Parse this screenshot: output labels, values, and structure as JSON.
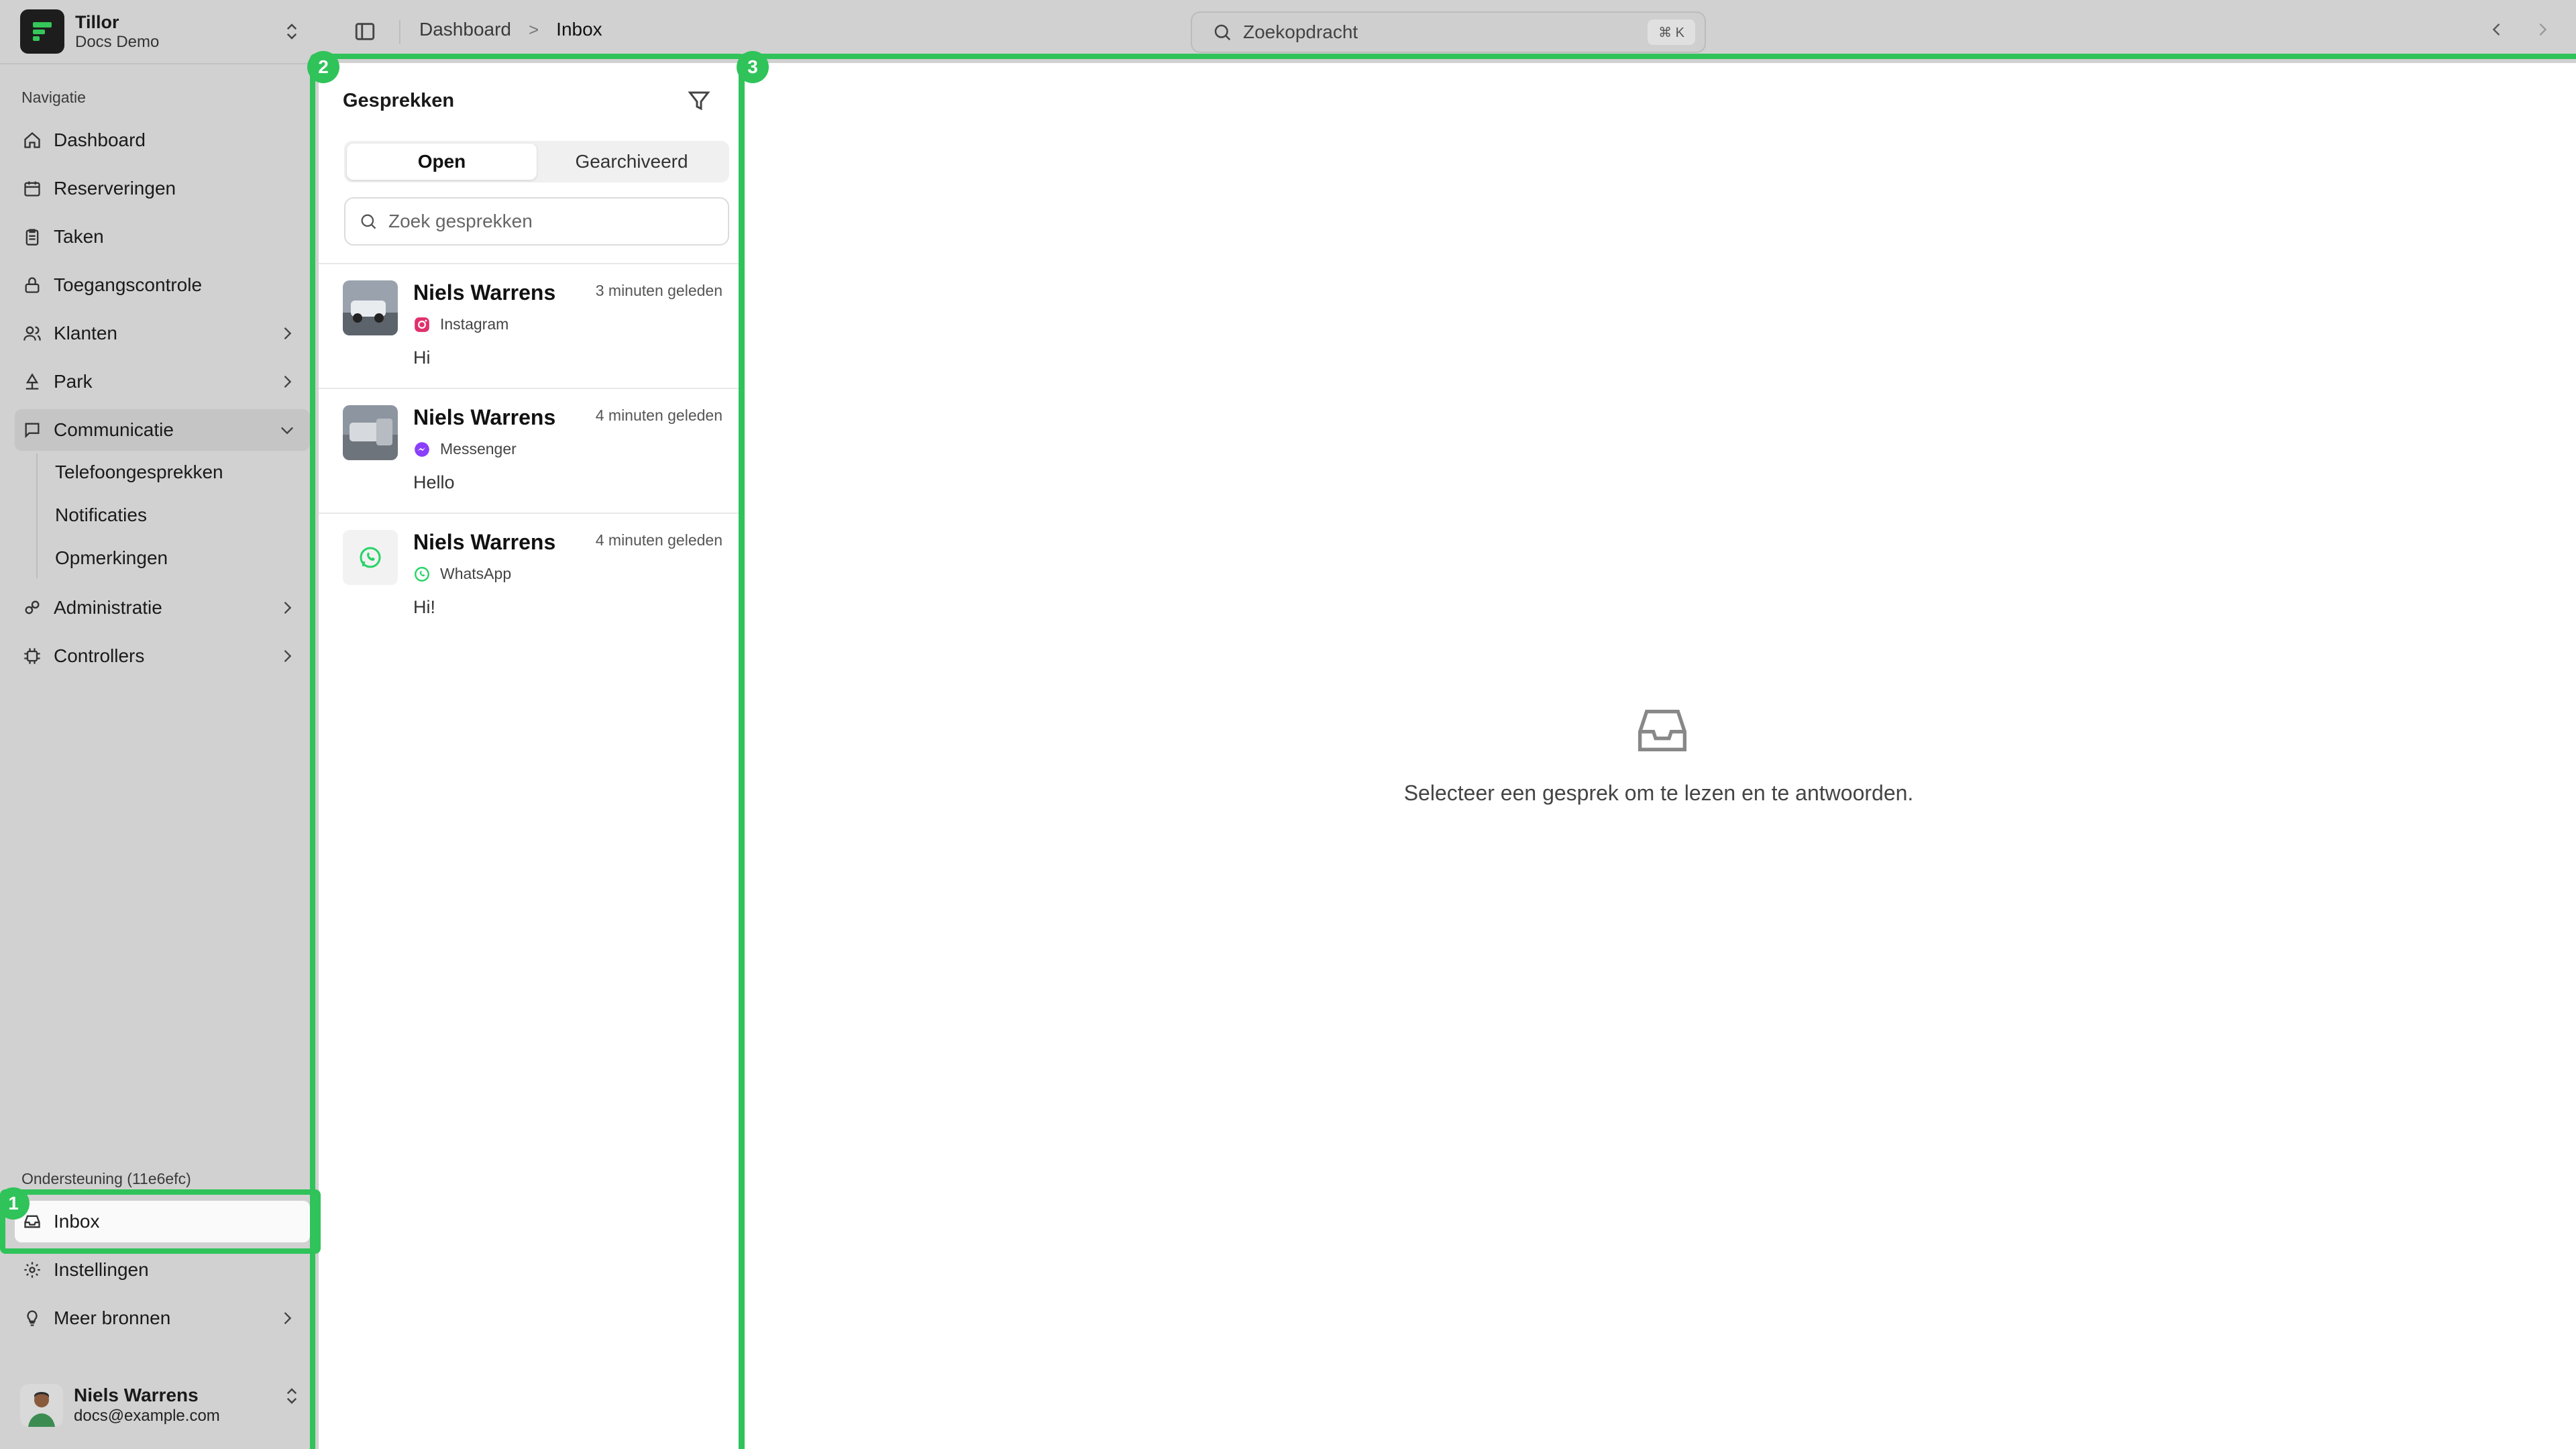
{
  "brand": {
    "name": "Tillor",
    "workspace": "Docs Demo"
  },
  "sidebar": {
    "section_nav": "Navigatie",
    "items": [
      {
        "label": "Dashboard",
        "icon": "home-icon"
      },
      {
        "label": "Reserveringen",
        "icon": "calendar-icon"
      },
      {
        "label": "Taken",
        "icon": "clipboard-icon"
      },
      {
        "label": "Toegangscontrole",
        "icon": "lock-icon"
      },
      {
        "label": "Klanten",
        "icon": "users-icon"
      },
      {
        "label": "Park",
        "icon": "park-icon"
      },
      {
        "label": "Communicatie",
        "icon": "chat-icon"
      },
      {
        "label": "Administratie",
        "icon": "admin-icon"
      },
      {
        "label": "Controllers",
        "icon": "chip-icon"
      }
    ],
    "communicatie_sub": [
      "Telefoongesprekken",
      "Notificaties",
      "Opmerkingen"
    ],
    "section_support": "Ondersteuning (11e6efc)",
    "support_items": [
      {
        "label": "Inbox",
        "icon": "inbox-icon"
      },
      {
        "label": "Instellingen",
        "icon": "gear-icon"
      },
      {
        "label": "Meer bronnen",
        "icon": "lightbulb-icon"
      }
    ],
    "user": {
      "name": "Niels Warrens",
      "email": "docs@example.com"
    }
  },
  "topbar": {
    "breadcrumb_parent": "Dashboard",
    "breadcrumb_sep": ">",
    "breadcrumb_current": "Inbox",
    "search_placeholder": "Zoekopdracht",
    "search_shortcut": "⌘ K"
  },
  "conversations": {
    "title": "Gesprekken",
    "tabs": [
      "Open",
      "Gearchiveerd"
    ],
    "search_placeholder": "Zoek gesprekken",
    "items": [
      {
        "name": "Niels Warrens",
        "time": "3 minuten geleden",
        "channel": "Instagram",
        "message": "Hi"
      },
      {
        "name": "Niels Warrens",
        "time": "4 minuten geleden",
        "channel": "Messenger",
        "message": "Hello"
      },
      {
        "name": "Niels Warrens",
        "time": "4 minuten geleden",
        "channel": "WhatsApp",
        "message": "Hi!"
      }
    ]
  },
  "main": {
    "empty_text": "Selecteer een gesprek om te lezen en te antwoorden."
  },
  "highlights": [
    "1",
    "2",
    "3"
  ],
  "colors": {
    "highlight": "#2fc35a",
    "instagram": "#e1306c",
    "messenger": "#8a3ffc",
    "whatsapp": "#25d366"
  }
}
